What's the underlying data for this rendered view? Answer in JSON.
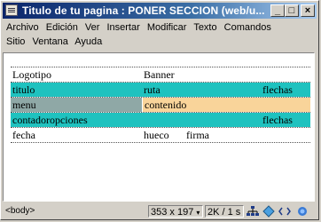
{
  "window": {
    "title": "Titulo de tu pagina : PONER SECCION (web/u..."
  },
  "title_buttons": {
    "minimize": "_",
    "maximize": "□",
    "close": "×"
  },
  "menu": {
    "row1": [
      "Archivo",
      "Edición",
      "Ver",
      "Insertar",
      "Modificar",
      "Texto",
      "Comandos"
    ],
    "row2": [
      "Sitio",
      "Ventana",
      "Ayuda"
    ]
  },
  "layout": {
    "row1": {
      "left": "Logotipo",
      "right": "Banner"
    },
    "row2": {
      "left": "titulo",
      "mid": "ruta",
      "right": "flechas"
    },
    "row3": {
      "left": "menu",
      "right": "contenido"
    },
    "row4": {
      "left": "contadoropciones",
      "right": "flechas"
    },
    "row5": {
      "left": "fecha",
      "mid1": "hueco",
      "mid2": "firma"
    }
  },
  "status": {
    "tag_path": "<body>",
    "size": "353 x 197",
    "download": "2K / 1 s"
  },
  "colors": {
    "teal": "#1fc2bf",
    "menu_cell": "#8fa8a6",
    "content_cell": "#f9d49a"
  }
}
